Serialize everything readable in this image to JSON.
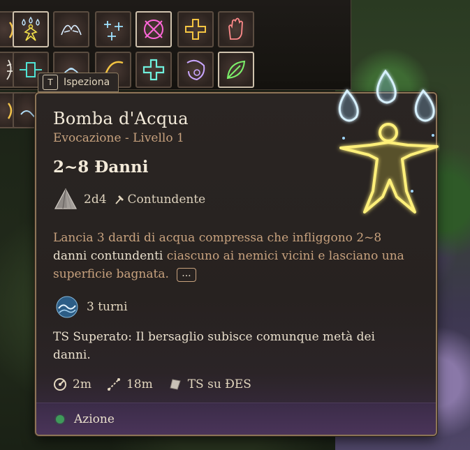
{
  "hotbar": {
    "slots": [
      {
        "icon": "sun-rune-icon"
      },
      {
        "icon": "water-drops-figure-icon"
      },
      {
        "icon": "feather-wings-icon"
      },
      {
        "icon": "sparkle-stars-icon"
      },
      {
        "icon": "crossed-circle-icon"
      },
      {
        "icon": "golden-cross-icon"
      },
      {
        "icon": "open-hand-icon"
      },
      {
        "icon": "feather-icon"
      },
      {
        "icon": "circuit-rune-icon"
      },
      {
        "icon": "splash-icon"
      },
      {
        "icon": "crescent-icon"
      },
      {
        "icon": "glowing-cross-icon"
      },
      {
        "icon": "skull-flame-icon"
      },
      {
        "icon": "green-leaf-icon"
      },
      {
        "icon": "golden-lash-icon"
      },
      {
        "icon": "wave-icon"
      }
    ]
  },
  "inspect": {
    "key": "T",
    "label": "Ispeziona"
  },
  "spell": {
    "name": "Bomba d'Acqua",
    "school_level": "Evocazione - Livello 1",
    "damage": "2~8 Đanni",
    "dice": "2d4",
    "damage_type": "Contundente",
    "description": {
      "part1": "Lancia 3 dardi di acqua compressa che infliggono 2~8",
      "part2": "danni contundenti",
      "part3": " ciascuno ai nemici vicini e lasciano una superficie bagnata.",
      "more": "..."
    },
    "duration": "3 turni",
    "saving_throw": "TS Superato: Il bersaglio subisce comunque metà dei danni.",
    "stats": {
      "area": "2m",
      "range": "18m",
      "save": "TS su ĐES"
    },
    "action": "Azione"
  },
  "colors": {
    "accent_title": "#f3ead9",
    "subtitle": "#c8a27e",
    "action_bar": "#4a3459",
    "action_dot": "#3f9a5a",
    "spell_glow": "#f5e34a",
    "water_glow": "#bfe6ff"
  }
}
